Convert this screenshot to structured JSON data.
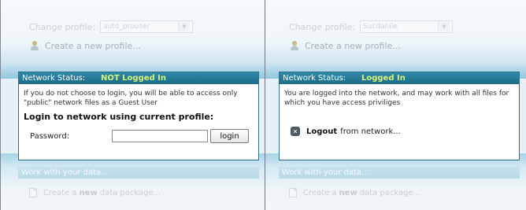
{
  "left_panel": {
    "change_profile_label": "Change profile:",
    "profile_value": "auto_prouser",
    "create_profile": "Create a new profile...",
    "status_label": "Network Status:",
    "status_value": "NOT Logged In",
    "status_text": "If you do not choose to login, you will be able to access only \"public\" network files as a Guest User",
    "login_heading": "Login to network using current profile:",
    "password_label": "Password:",
    "password_value": "",
    "login_button": "login",
    "work_header": "Work with your data...",
    "create_package_prefix": "Create a",
    "create_package_new": "new",
    "create_package_suffix": "data package..."
  },
  "right_panel": {
    "change_profile_label": "Change profile:",
    "profile_value": "Sucdanile",
    "create_profile": "Create a new profile...",
    "status_label": "Network Status:",
    "status_value": "Logged In",
    "status_text": "You are logged into the network, and may work with all files for which you have access priviliges",
    "logout_strong": "Logout",
    "logout_rest": "from network...",
    "work_header": "Work with your data...",
    "create_package_prefix": "Create a",
    "create_package_new": "new",
    "create_package_suffix": "data package..."
  },
  "colors": {
    "header_bg": "#1e6b86",
    "status_accent": "#d8f27a"
  }
}
